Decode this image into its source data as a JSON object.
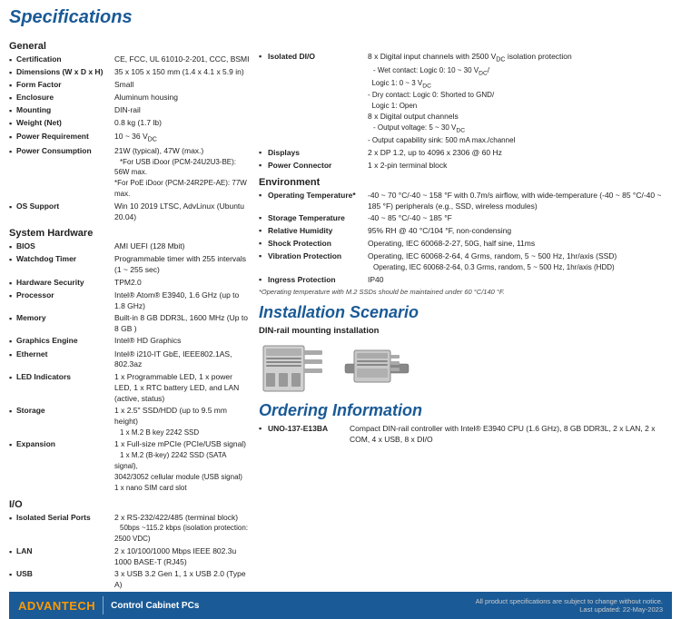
{
  "page": {
    "title": "Specifications"
  },
  "left": {
    "general": {
      "heading": "General",
      "rows": [
        {
          "label": "Certification",
          "value": "CE, FCC, UL 61010-2-201, CCC, BSMI"
        },
        {
          "label": "Dimensions (W x D x H)",
          "value": "35 x 105 x 150 mm (1.4 x 4.1 x 5.9 in)"
        },
        {
          "label": "Form Factor",
          "value": "Small"
        },
        {
          "label": "Enclosure",
          "value": "Aluminum housing"
        },
        {
          "label": "Mounting",
          "value": "DIN-rail"
        },
        {
          "label": "Weight (Net)",
          "value": "0.8 kg (1.7 lb)"
        },
        {
          "label": "Power Requirement",
          "value": "10 ~ 36 VDC"
        },
        {
          "label": "Power Consumption",
          "value": "21W (typical), 47W (max.)",
          "sub": [
            "*For USB iDoor (PCM-24U2U3-BE): 56W max.",
            "*For PoE iDoor (PCM-24R2PE-AE): 77W max."
          ]
        },
        {
          "label": "OS Support",
          "value": "Win 10 2019 LTSC, AdvLinux (Ubuntu 20.04)"
        }
      ]
    },
    "system_hardware": {
      "heading": "System Hardware",
      "rows": [
        {
          "label": "BIOS",
          "value": "AMI UEFI (128 Mbit)"
        },
        {
          "label": "Watchdog Timer",
          "value": "Programmable timer with 255 intervals (1 ~ 255 sec)"
        },
        {
          "label": "Hardware Security",
          "value": "TPM2.0"
        },
        {
          "label": "Processor",
          "value": "Intel® Atom® E3940, 1.6 GHz (up to 1.8 GHz)"
        },
        {
          "label": "Memory",
          "value": "Built-in 8 GB DDR3L, 1600 MHz (Up to 8 GB )"
        },
        {
          "label": "Graphics Engine",
          "value": "Intel® HD Graphics"
        },
        {
          "label": "Ethernet",
          "value": "Intel® i210-IT GbE, IEEE802.1AS, 802.3az"
        },
        {
          "label": "LED Indicators",
          "value": "1 x Programmable LED, 1 x power LED, 1 x RTC battery LED, and LAN (active, status)"
        },
        {
          "label": "Storage",
          "value": "1 x 2.5\" SSD/HDD (up to 9.5 mm height)",
          "sub": [
            "1 x M.2 B key 2242 SSD"
          ]
        },
        {
          "label": "Expansion",
          "value": "1 x Full-size mPCIe (PCIe/USB signal)",
          "sub": [
            "1 x M.2 (B-key) 2242 SSD (SATA signal), 3042/3052 cellular module (USB signal)",
            "1 x nano SIM card slot"
          ]
        }
      ]
    },
    "io": {
      "heading": "I/O",
      "rows": [
        {
          "label": "Isolated Serial Ports",
          "value": "2 x RS-232/422/485 (terminal block)",
          "sub": [
            "50bps ~115.2 kbps (isolation protection: 2500 VDC)"
          ]
        },
        {
          "label": "LAN",
          "value": "2 x 10/100/1000 Mbps IEEE 802.3u 1000 BASE-T (RJ45)"
        },
        {
          "label": "USB",
          "value": "3 x USB 3.2 Gen 1, 1 x USB 2.0 (Type A)"
        }
      ]
    }
  },
  "right": {
    "io_section": {
      "rows": [
        {
          "label": "Isolated DI/O",
          "value": "8 x Digital input channels with 2500 VDC isolation protection",
          "sub": [
            "- Wet contact: Logic 0: 10 ~ 30 VDC/",
            "  Logic 1: 0 ~ 3 VDC",
            "- Dry contact: Logic 0: Shorted to GND/",
            "  Logic 1: Open",
            "8 x Digital output channels",
            "- Output voltage: 5 ~ 30 VDC",
            "- Output capability sink: 500 mA max./channel"
          ]
        },
        {
          "label": "Displays",
          "value": "2 x DP 1.2, up to 4096 x 2306 @ 60 Hz"
        },
        {
          "label": "Power Connector",
          "value": "1 x 2-pin terminal block"
        }
      ]
    },
    "environment": {
      "heading": "Environment",
      "rows": [
        {
          "label": "Operating Temperature*",
          "value": "-40 ~ 70 °C/-40 ~ 158 °F with 0.7m/s airflow, with wide-temperature (-40 ~ 85 °C/-40 ~ 185 °F) peripherals (e.g., SSD, wireless modules)"
        },
        {
          "label": "Storage Temperature",
          "value": "-40 ~ 85 °C/-40 ~ 185 °F"
        },
        {
          "label": "Relative Humidity",
          "value": "95% RH @ 40 °C/104 °F, non-condensing"
        },
        {
          "label": "Shock Protection",
          "value": "Operating, IEC 60068-2-27, 50G, half sine, 11ms"
        },
        {
          "label": "Vibration Protection",
          "value": "Operating, IEC 60068-2-64, 4 Grms, random, 5 ~ 500 Hz, 1hr/axis (SSD)",
          "sub": [
            "Operating, IEC 60068-2-64, 0.3 Grms, random, 5 ~ 500 Hz, 1hr/axis (HDD)"
          ]
        },
        {
          "label": "Ingress Protection",
          "value": "IP40"
        }
      ],
      "note": "*Operating temperature with M.2 SSDs should be maintained under 60 °C/140 °F."
    },
    "installation": {
      "heading": "Installation Scenario",
      "sub_heading": "DIN-rail mounting installation"
    },
    "ordering": {
      "heading": "Ordering Information",
      "rows": [
        {
          "model": "UNO-137-E13BA",
          "desc": "Compact DIN-rail controller with Intel® E3940 CPU (1.6 GHz), 8 GB DDR3L, 2 x LAN, 2 x COM, 4 x USB, 8 x DI/O"
        }
      ]
    }
  },
  "footer": {
    "logo": "ADVANTECH",
    "logo_accent": "ADV",
    "product_line": "Control Cabinet PCs",
    "note": "All product specifications are subject to change without notice.",
    "date": "Last updated: 22-May-2023"
  }
}
